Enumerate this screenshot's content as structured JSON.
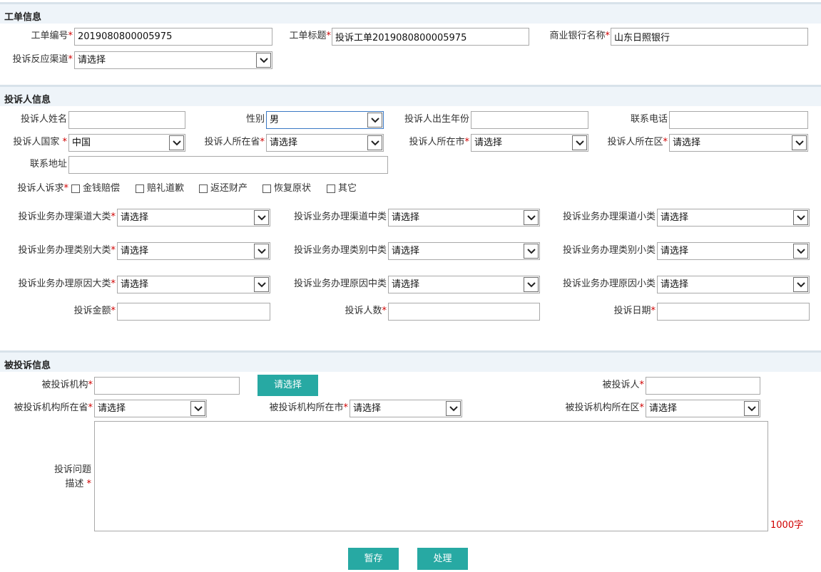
{
  "sections": {
    "work_order": "工单信息",
    "complainant": "投诉人信息",
    "respondent": "被投诉信息"
  },
  "work_order": {
    "number_label": "工单编号",
    "number_value": "2019080800005975",
    "title_label": "工单标题",
    "title_value": "投诉工单2019080800005975",
    "bank_label": "商业银行名称",
    "bank_value": "山东日照银行",
    "channel_label": "投诉反应渠道",
    "channel_value": "请选择"
  },
  "complainant": {
    "name_label": "投诉人姓名",
    "gender_label": "性别",
    "gender_value": "男",
    "birth_label": "投诉人出生年份",
    "phone_label": "联系电话",
    "country_label": "投诉人国家 ",
    "country_value": "中国",
    "province_label": "投诉人所在省",
    "province_value": "请选择",
    "city_label": "投诉人所在市",
    "city_value": "请选择",
    "district_label": "投诉人所在区",
    "district_value": "请选择",
    "address_label": "联系地址",
    "demand_label": "投诉人诉求",
    "demands": [
      "金钱赔偿",
      "赔礼道歉",
      "返还财产",
      "恢复原状",
      "其它"
    ],
    "channel_major_label": "投诉业务办理渠道大类",
    "channel_mid_label": "投诉业务办理渠道中类",
    "channel_minor_label": "投诉业务办理渠道小类",
    "type_major_label": "投诉业务办理类别大类",
    "type_mid_label": "投诉业务办理类别中类",
    "type_minor_label": "投诉业务办理类别小类",
    "reason_major_label": "投诉业务办理原因大类",
    "reason_mid_label": "投诉业务办理原因中类",
    "reason_minor_label": "投诉业务办理原因小类",
    "select_placeholder": "请选择",
    "amount_label": "投诉金额",
    "count_label": "投诉人数",
    "date_label": "投诉日期"
  },
  "respondent": {
    "org_label": "被投诉机构",
    "org_button": "请选择",
    "person_label": "被投诉人",
    "province_label": "被投诉机构所在省",
    "province_value": "请选择",
    "city_label": "被投诉机构所在市",
    "city_value": "请选择",
    "district_label": "被投诉机构所在区",
    "district_value": "请选择",
    "desc_label_line1": "投诉问题",
    "desc_label_line2": "描述 ",
    "char_limit": "1000字"
  },
  "actions": {
    "save": "暂存",
    "process": "处理"
  },
  "required_mark": "*",
  "colors": {
    "section_bg": "#eef4f9",
    "required": "#d00000",
    "button": "#27a9a3",
    "focus_border": "#3b79c4"
  }
}
